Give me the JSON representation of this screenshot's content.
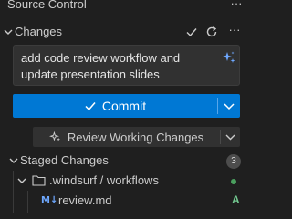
{
  "header": {
    "title": "Source Control",
    "more_label": "···"
  },
  "changes": {
    "label": "Changes",
    "icons": [
      "checkmark-icon",
      "refresh-icon",
      "more-icon"
    ],
    "more_label": "···"
  },
  "commit_message": {
    "value": "add code review workflow and update presentation slides",
    "icon": "sparkle-icon"
  },
  "commit_button": {
    "label": "Commit",
    "icon": "checkmark-icon",
    "dropdown_icon": "chevron-down-icon"
  },
  "review_button": {
    "label": "Review Working Changes",
    "icon": "sparkle-icon",
    "dropdown_icon": "chevron-down-icon"
  },
  "staged": {
    "label": "Staged Changes",
    "count": "3",
    "folder": {
      "name": ".windsurf",
      "separator": " / ",
      "sub": "workflows"
    },
    "files": [
      {
        "icon_text": "M↓",
        "name": "review.md",
        "status": "A"
      }
    ]
  },
  "colors": {
    "accent": "#0078d4",
    "background": "#1f1f1f",
    "added": "#73c991"
  }
}
